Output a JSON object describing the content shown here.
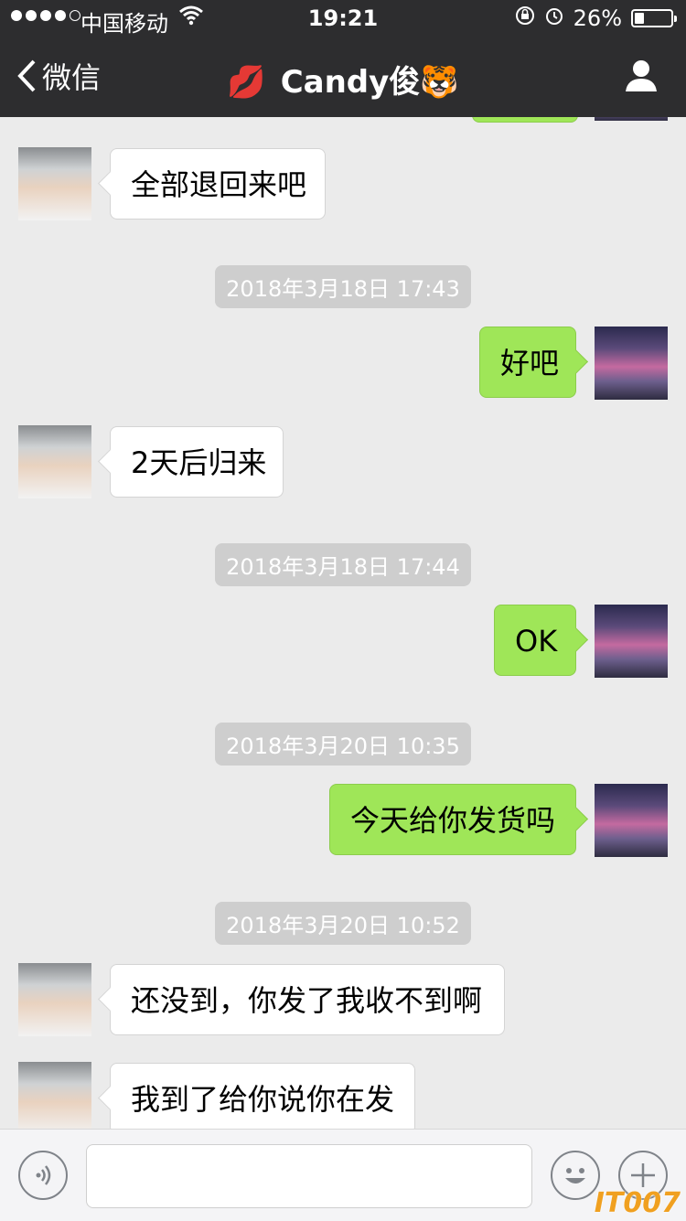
{
  "status_bar": {
    "carrier": "中国移动",
    "time": "19:21",
    "battery_text": "26%",
    "battery_level": 0.26
  },
  "nav": {
    "back_label": "微信",
    "title": "Candy俊🐯",
    "title_prefix_emoji": "💋"
  },
  "messages": [
    {
      "type": "in",
      "text": "全部退回来吧"
    },
    {
      "type": "time",
      "text": "2018年3月18日 17:43"
    },
    {
      "type": "out",
      "text": "好吧"
    },
    {
      "type": "in",
      "text": "2天后归来"
    },
    {
      "type": "time",
      "text": "2018年3月18日 17:44"
    },
    {
      "type": "out",
      "text": "OK"
    },
    {
      "type": "time",
      "text": "2018年3月20日 10:35"
    },
    {
      "type": "out",
      "text": "今天给你发货吗"
    },
    {
      "type": "time",
      "text": "2018年3月20日 10:52"
    },
    {
      "type": "in",
      "text": "还没到，你发了我收不到啊"
    },
    {
      "type": "in",
      "text": "我到了给你说你在发"
    }
  ],
  "input_bar": {
    "voice_icon": "voice-icon",
    "emoji_icon": "emoji-icon",
    "plus_icon": "plus-icon"
  },
  "watermark": "IT007",
  "colors": {
    "nav_bg": "#2d2d2f",
    "chat_bg": "#ebebeb",
    "out_bubble": "#9fe658",
    "in_bubble": "#ffffff"
  }
}
